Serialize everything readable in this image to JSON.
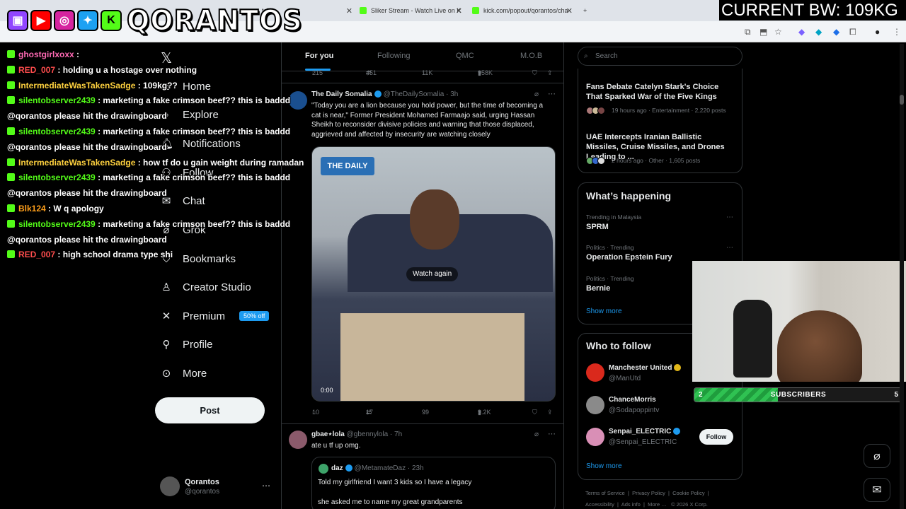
{
  "browser": {
    "tabs": [
      {
        "label": "tch"
      },
      {
        "label": "Sliker Stream - Watch Live on K"
      },
      {
        "label": "kick.com/popout/qorantos/cha"
      }
    ],
    "new_tab": "+"
  },
  "overlay": {
    "stream_name": "QORANTOS",
    "bw": "CURRENT BW: 109KG",
    "sub_bar": {
      "left": "2",
      "label": "SUBSCRIBERS",
      "right": "5",
      "progress": 0.4
    }
  },
  "chat": [
    {
      "user": "ghostgirlxoxx",
      "color": "#ff69b4",
      "msg": ":",
      "extra": ""
    },
    {
      "user": "RED_007",
      "color": "#ff4d4d",
      "msg": ": holding u a hostage over nothing",
      "extra": ""
    },
    {
      "user": "IntermediateWasTakenSadge",
      "color": "#ffd23f",
      "msg": ": 109kg??",
      "extra": ""
    },
    {
      "user": "silentobserver2439",
      "color": "#53fc18",
      "msg": ": marketing a fake crimson beef?? this is baddd",
      "extra": "@qorantos please hit the drawingboard"
    },
    {
      "user": "silentobserver2439",
      "color": "#53fc18",
      "msg": ": marketing a fake crimson beef?? this is baddd",
      "extra": "@qorantos please hit the drawingboard"
    },
    {
      "user": "IntermediateWasTakenSadge",
      "color": "#ffd23f",
      "msg": ": how tf do u gain weight during ramadan",
      "extra": ""
    },
    {
      "user": "silentobserver2439",
      "color": "#53fc18",
      "msg": ": marketing a fake crimson beef?? this is baddd",
      "extra": "@qorantos please hit the drawingboard"
    },
    {
      "user": "Blk124",
      "color": "#ff9f1a",
      "msg": ": W q apology",
      "extra": ""
    },
    {
      "user": "silentobserver2439",
      "color": "#53fc18",
      "msg": ": marketing a fake crimson beef?? this is baddd",
      "extra": "@qorantos please hit the drawingboard"
    },
    {
      "user": "RED_007",
      "color": "#ff4d4d",
      "msg": ": high school drama type shi",
      "extra": ""
    }
  ],
  "nav": {
    "items": [
      {
        "label": "Home",
        "icon": "home-icon"
      },
      {
        "label": "Explore",
        "icon": "search-icon"
      },
      {
        "label": "Notifications",
        "icon": "bell-icon"
      },
      {
        "label": "Follow",
        "icon": "person-plus-icon"
      },
      {
        "label": "Chat",
        "icon": "mail-icon"
      },
      {
        "label": "Grok",
        "icon": "grok-icon"
      },
      {
        "label": "Bookmarks",
        "icon": "bookmark-icon"
      },
      {
        "label": "Creator Studio",
        "icon": "bolt-icon"
      },
      {
        "label": "Premium",
        "icon": "x-icon"
      },
      {
        "label": "Profile",
        "icon": "person-icon"
      },
      {
        "label": "More",
        "icon": "more-icon"
      }
    ],
    "premium_badge": "50% off",
    "post": "Post",
    "account": {
      "name": "Qorantos",
      "handle": "@qorantos"
    }
  },
  "timeline": {
    "tabs": [
      "For you",
      "Following",
      "QMC",
      "M.O.B"
    ],
    "prev_stats": {
      "replies": "215",
      "reposts": "451",
      "likes": "11K",
      "views": "958K"
    },
    "tweet1": {
      "name": "The Daily Somalia",
      "handle": "@TheDailySomalia",
      "time": "3h",
      "text": "\"Today you are a lion because you hold power, but the time of becoming a cat is near,\" Former President Mohamed Farmaajo said, urging Hassan Sheikh to reconsider divisive policies and warning that those displaced, aggrieved and affected by insecurity are watching closely",
      "media_logo": "THE DAILY",
      "watch_again": "Watch again",
      "video_time": "0:00",
      "stats": {
        "replies": "10",
        "reposts": "17",
        "likes": "99",
        "views": "9.2K"
      }
    },
    "tweet2": {
      "name": "gbae⋆lola",
      "handle": "@gbennylola",
      "time": "7h",
      "text": "ate u tf up omg.",
      "quote": {
        "name": "daz",
        "handle": "@MetamateDaz",
        "time": "23h",
        "line1": "Told my girlfriend I want 3 kids so I have a legacy",
        "line2": "she asked me to name my great grandparents"
      }
    }
  },
  "right": {
    "search_placeholder": "Search",
    "news": [
      {
        "title": "Fans Debate Catelyn Stark's Choice That Sparked War of the Five Kings",
        "meta": "19 hours ago · Entertainment · 2,220 posts"
      },
      {
        "title": "UAE Intercepts Iranian Ballistic Missiles, Cruise Missiles, and Drones Leading to ...",
        "meta": "2 hours ago · Other · 1,605 posts"
      }
    ],
    "happening": {
      "title": "What’s happening",
      "trends": [
        {
          "context": "Trending in Malaysia",
          "name": "SPRM"
        },
        {
          "context": "Politics · Trending",
          "name": "Operation Epstein Fury"
        },
        {
          "context": "Politics · Trending",
          "name": "Bernie"
        }
      ],
      "show_more": "Show more"
    },
    "who": {
      "title": "Who to follow",
      "accounts": [
        {
          "name": "Manchester United",
          "handle": "@ManUtd",
          "color": "#da291c"
        },
        {
          "name": "ChanceMorris",
          "handle": "@Sodapoppintv",
          "color": "#8a8a8a"
        },
        {
          "name": "Senpai_ELECTRIC",
          "handle": "@Senpai_ELECTRIC",
          "color": "#d98fb6"
        }
      ],
      "follow": "Follow",
      "show_more": "Show more"
    },
    "footer": {
      "row1": [
        "Terms of Service",
        "Privacy Policy",
        "Cookie Policy"
      ],
      "row2": [
        "Accessibility",
        "Ads info",
        "More …",
        "© 2026 X Corp."
      ]
    }
  }
}
